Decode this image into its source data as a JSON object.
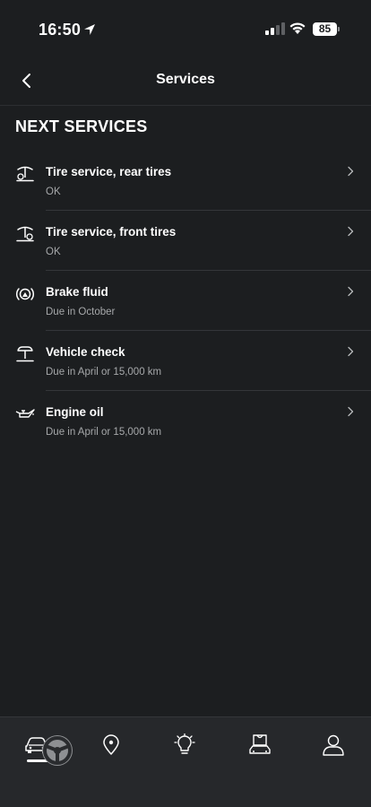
{
  "status_bar": {
    "time": "16:50",
    "battery": "85"
  },
  "header": {
    "title": "Services"
  },
  "section": {
    "title": "NEXT SERVICES"
  },
  "services": [
    {
      "title": "Tire service, rear tires",
      "status": "OK",
      "icon": "tire-lift-icon"
    },
    {
      "title": "Tire service, front tires",
      "status": "OK",
      "icon": "tire-lift-icon"
    },
    {
      "title": "Brake fluid",
      "status": "Due in October",
      "icon": "brake-icon"
    },
    {
      "title": "Vehicle check",
      "status": "Due in April  or 15,000 km",
      "icon": "vehicle-lift-icon"
    },
    {
      "title": "Engine oil",
      "status": "Due in April  or 15,000 km",
      "icon": "oil-can-icon"
    }
  ],
  "tab_bar": {
    "tabs": [
      {
        "icon": "car-icon",
        "active": true
      },
      {
        "icon": "map-pin-icon",
        "active": false
      },
      {
        "icon": "lightbulb-icon",
        "active": false
      },
      {
        "icon": "shop-icon",
        "active": false
      },
      {
        "icon": "profile-icon",
        "active": false
      }
    ]
  },
  "colors": {
    "background": "#1c1e20",
    "tab_bar": "#26282b",
    "text_primary": "#ffffff",
    "text_secondary": "#a6a8aa",
    "separator": "#34363a"
  }
}
